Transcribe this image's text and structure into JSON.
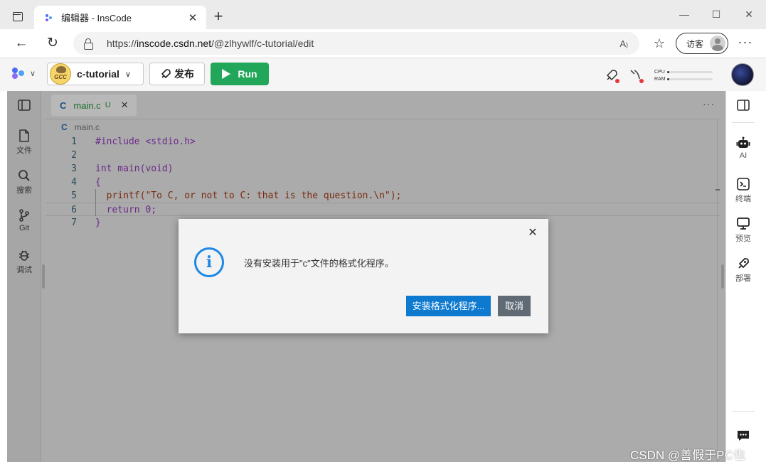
{
  "browser": {
    "tab_title": "编辑器 - InsCode",
    "url_prefix": "https://",
    "url_host": "inscode.csdn.net",
    "url_path": "/@zlhywlf/c-tutorial/edit",
    "guest_label": "访客",
    "icons": [
      "tab-actions-icon",
      "close-icon",
      "plus-icon",
      "minimize-icon",
      "maximize-icon",
      "back-icon",
      "reload-icon",
      "lock-icon",
      "read-aloud-icon",
      "favorites-icon",
      "more-icon"
    ]
  },
  "header": {
    "project_name": "c-tutorial",
    "publish_label": "发布",
    "run_label": "Run",
    "cpu_label": "CPU",
    "ram_label": "RAM",
    "cpu_usage": 0.05,
    "ram_usage": 0.05,
    "colors": {
      "run": "#22a65a",
      "alert_dot": "#e5373a"
    }
  },
  "left_rail": {
    "items": [
      {
        "label": "文件",
        "icon": "file-icon"
      },
      {
        "label": "搜索",
        "icon": "search-icon"
      },
      {
        "label": "Git",
        "icon": "git-branch-icon"
      },
      {
        "label": "调试",
        "icon": "bug-icon"
      }
    ]
  },
  "editor": {
    "tab_name": "main.c",
    "tab_status": "U",
    "breadcrumb": "main.c",
    "lines": [
      {
        "n": "1",
        "text": "#include <stdio.h>"
      },
      {
        "n": "2",
        "text": ""
      },
      {
        "n": "3",
        "text": "int main(void)"
      },
      {
        "n": "4",
        "text": "{"
      },
      {
        "n": "5",
        "text": "  printf(\"To C, or not to C: that is the question.\\n\");"
      },
      {
        "n": "6",
        "text": "  return 0;"
      },
      {
        "n": "7",
        "text": "}"
      }
    ]
  },
  "right_rail": {
    "items": [
      {
        "label": "AI",
        "icon": "robot-icon"
      },
      {
        "label": "终端",
        "icon": "terminal-icon"
      },
      {
        "label": "预览",
        "icon": "monitor-icon"
      },
      {
        "label": "部署",
        "icon": "rocket-icon"
      }
    ]
  },
  "dialog": {
    "message": "没有安装用于\"c\"文件的格式化程序。",
    "primary_label": "安装格式化程序...",
    "secondary_label": "取消",
    "colors": {
      "info": "#1e88e5",
      "primary": "#0e7acf",
      "secondary": "#5f6a75"
    }
  },
  "watermark": "CSDN @善假于PC也"
}
